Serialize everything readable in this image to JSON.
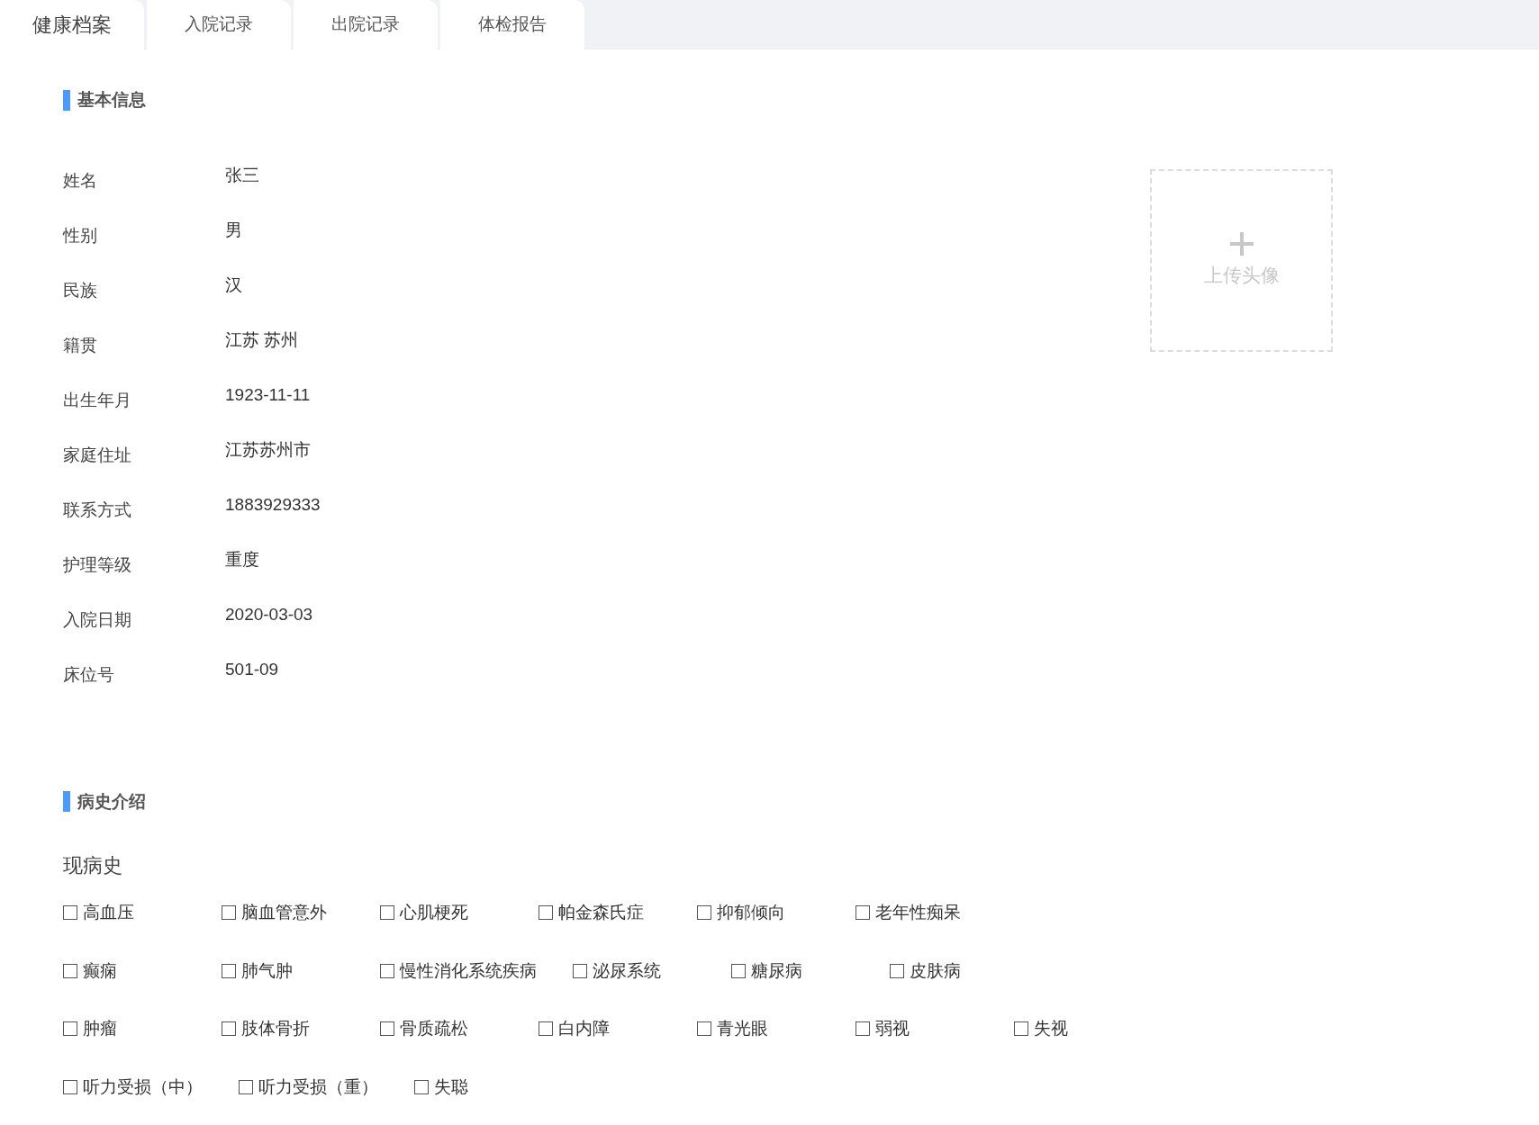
{
  "tabs": [
    {
      "label": "健康档案",
      "selected": true
    },
    {
      "label": "入院记录",
      "selected": false
    },
    {
      "label": "出院记录",
      "selected": false
    },
    {
      "label": "体检报告",
      "selected": false
    }
  ],
  "basic_info": {
    "title": "基本信息",
    "fields": [
      {
        "label": "姓名",
        "value": "张三"
      },
      {
        "label": "性别",
        "value": "男"
      },
      {
        "label": "民族",
        "value": "汉"
      },
      {
        "label": "籍贯",
        "value": "江苏 苏州"
      },
      {
        "label": "出生年月",
        "value": "1923-11-11"
      },
      {
        "label": "家庭住址",
        "value": "江苏苏州市"
      },
      {
        "label": "联系方式",
        "value": "1883929333"
      },
      {
        "label": "护理等级",
        "value": "重度"
      },
      {
        "label": "入院日期",
        "value": "2020-03-03"
      },
      {
        "label": "床位号",
        "value": "501-09"
      }
    ],
    "avatar_upload": {
      "label": "上传头像"
    }
  },
  "medical_history": {
    "title": "病史介绍",
    "subtitle": "现病史",
    "rows": [
      [
        {
          "label": "高血压",
          "checked": false
        },
        {
          "label": "脑血管意外",
          "checked": false
        },
        {
          "label": "心肌梗死",
          "checked": false
        },
        {
          "label": "帕金森氏症",
          "checked": false
        },
        {
          "label": "抑郁倾向",
          "checked": false
        },
        {
          "label": "老年性痴呆",
          "checked": false
        }
      ],
      [
        {
          "label": "癫痫",
          "checked": false
        },
        {
          "label": "肺气肿",
          "checked": false
        },
        {
          "label": "慢性消化系统疾病",
          "checked": false
        },
        {
          "label": "泌尿系统",
          "checked": false
        },
        {
          "label": "糖尿病",
          "checked": false
        },
        {
          "label": "皮肤病",
          "checked": false
        }
      ],
      [
        {
          "label": "肿瘤",
          "checked": false
        },
        {
          "label": "肢体骨折",
          "checked": false
        },
        {
          "label": "骨质疏松",
          "checked": false
        },
        {
          "label": "白内障",
          "checked": false
        },
        {
          "label": "青光眼",
          "checked": false
        },
        {
          "label": "弱视",
          "checked": false
        },
        {
          "label": "失视",
          "checked": false
        }
      ],
      [
        {
          "label": "听力受损（中）",
          "checked": false
        },
        {
          "label": "听力受损（重）",
          "checked": false
        },
        {
          "label": "失聪",
          "checked": false
        }
      ]
    ]
  }
}
